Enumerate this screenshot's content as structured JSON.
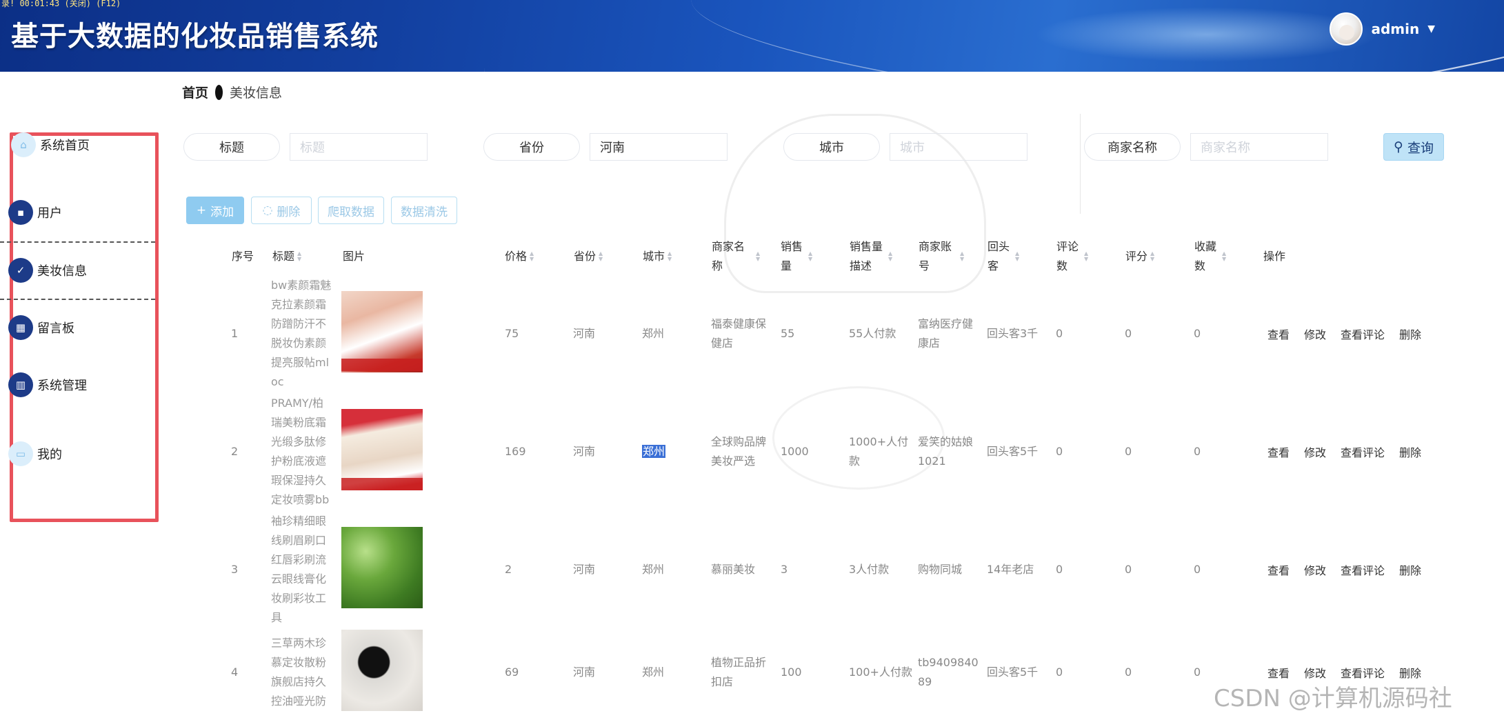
{
  "header": {
    "status_line": "录! 00:01:43 (关闭) (F12)",
    "title": "基于大数据的化妆品销售系统",
    "username": "admin",
    "caret": "▼"
  },
  "breadcrumb": {
    "home": "首页",
    "current": "美妆信息"
  },
  "sidebar": {
    "items": [
      {
        "label": "系统首页",
        "icon": "home-icon",
        "glyph": "⌂"
      },
      {
        "label": "用户",
        "icon": "chat-icon",
        "glyph": "▪"
      },
      {
        "label": "美妆信息",
        "icon": "clipboard-icon",
        "glyph": "✓"
      },
      {
        "label": "留言板",
        "icon": "grid-icon",
        "glyph": "▦"
      },
      {
        "label": "系统管理",
        "icon": "bars-icon",
        "glyph": "▥"
      },
      {
        "label": "我的",
        "icon": "card-icon",
        "glyph": "▭"
      }
    ]
  },
  "search": {
    "title_label": "标题",
    "title_placeholder": "标题",
    "title_value": "",
    "province_label": "省份",
    "province_value": "河南",
    "city_label": "城市",
    "city_placeholder": "城市",
    "city_value": "",
    "merchant_label": "商家名称",
    "merchant_placeholder": "商家名称",
    "merchant_value": "",
    "button": "查询",
    "button_icon": "search-icon"
  },
  "actions": {
    "add": "添加",
    "delete": "删除",
    "crawl": "爬取数据",
    "clean": "数据清洗"
  },
  "table": {
    "headers": [
      "序号",
      "标题",
      "图片",
      "价格",
      "省份",
      "城市",
      "商家名称",
      "销售量",
      "销售量描述",
      "商家账号",
      "回头客",
      "评论数",
      "评分",
      "收藏数",
      "操作"
    ],
    "row_actions": [
      "查看",
      "修改",
      "查看评论",
      "删除"
    ],
    "rows": [
      {
        "no": "1",
        "title": "bw素颜霜魅克拉素颜霜防蹭防汗不脱妆伪素颜提亮服帖mloc",
        "price": "75",
        "province": "河南",
        "city": "郑州",
        "merchant": "福泰健康保健店",
        "sales": "55",
        "sales_desc": "55人付款",
        "account": "富纳医疗健康店",
        "repeat": "回头客3千",
        "comments": "0",
        "score": "0",
        "favorites": "0"
      },
      {
        "no": "2",
        "title": "PRAMY/柏瑞美粉底霜光缎多肽修护粉底液遮瑕保湿持久定妆喷雾bb",
        "price": "169",
        "province": "河南",
        "city": "郑州",
        "merchant": "全球购品牌美妆严选",
        "sales": "1000",
        "sales_desc": "1000+人付款",
        "account": "爱笑的姑娘1021",
        "repeat": "回头客5千",
        "comments": "0",
        "score": "0",
        "favorites": "0"
      },
      {
        "no": "3",
        "title": "袖珍精细眼线刷眉刷口红唇彩刷流云眼线膏化妆刷彩妆工具",
        "price": "2",
        "province": "河南",
        "city": "郑州",
        "merchant": "慕丽美妆",
        "sales": "3",
        "sales_desc": "3人付款",
        "account": "购物同城",
        "repeat": "14年老店",
        "comments": "0",
        "score": "0",
        "favorites": "0"
      },
      {
        "no": "4",
        "title": "三草两木珍慕定妆散粉旗舰店持久控油哑光防",
        "price": "69",
        "province": "河南",
        "city": "郑州",
        "merchant": "植物正品折扣店",
        "sales": "100",
        "sales_desc": "100+人付款",
        "account": "tb940984089",
        "repeat": "回头客5千",
        "comments": "0",
        "score": "0",
        "favorites": "0"
      }
    ]
  },
  "watermark": "CSDN @计算机源码社"
}
